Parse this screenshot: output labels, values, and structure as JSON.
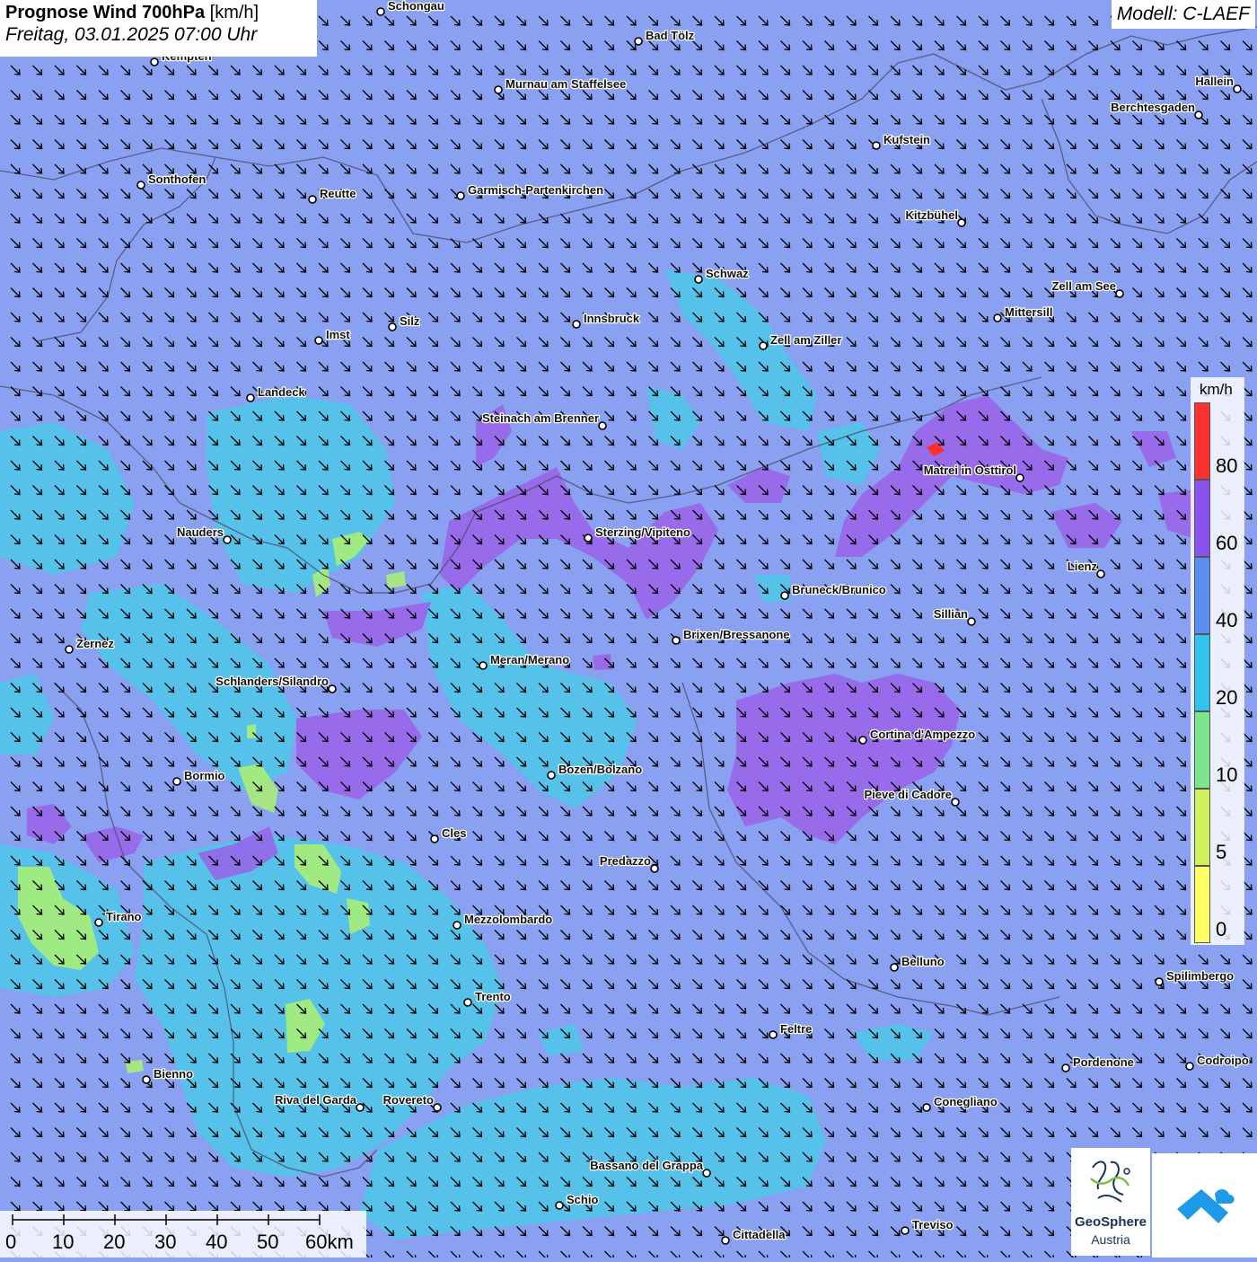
{
  "header": {
    "title_bold": "Prognose Wind 700hPa",
    "title_unit": "[km/h]",
    "datetime": "Freitag, 03.01.2025 07:00 Uhr"
  },
  "model": "Modell: C-LAEF",
  "legend": {
    "unit": "km/h",
    "ticks": [
      "80",
      "60",
      "40",
      "20",
      "10",
      "5",
      "0"
    ],
    "colors": [
      "#ff3030",
      "#8c52ef",
      "#5a8ef0",
      "#31c3ee",
      "#7ce68c",
      "#cdf25a",
      "#ffff66"
    ]
  },
  "scalebar": {
    "labels": [
      "0",
      "10",
      "20",
      "30",
      "40",
      "50",
      "60km"
    ]
  },
  "logos": {
    "geosphere_line1": "GeoSphere",
    "geosphere_line2": "Austria"
  },
  "colors": {
    "background": "#8aa0f0",
    "zone_cyan": "#4ec8e8",
    "zone_purple": "#9a62ea",
    "zone_green": "#a8ee78",
    "zone_red": "#ff3030",
    "arrow": "#000000"
  },
  "places": [
    {
      "name": "Schongau"
    },
    {
      "name": "Bad Tölz"
    },
    {
      "name": "Kempten"
    },
    {
      "name": "Murnau am Staffelsee"
    },
    {
      "name": "Hallein"
    },
    {
      "name": "Berchtesgaden"
    },
    {
      "name": "Kufstein"
    },
    {
      "name": "Sonthofen"
    },
    {
      "name": "Reutte"
    },
    {
      "name": "Garmisch-Partenkirchen"
    },
    {
      "name": "Kitzbühel"
    },
    {
      "name": "Schwaz"
    },
    {
      "name": "Zell am See"
    },
    {
      "name": "Mittersill"
    },
    {
      "name": "Innsbruck"
    },
    {
      "name": "Silz"
    },
    {
      "name": "Imst"
    },
    {
      "name": "Zell am Ziller"
    },
    {
      "name": "Landeck"
    },
    {
      "name": "Steinach am Brenner"
    },
    {
      "name": "Matrei in Osttirol"
    },
    {
      "name": "Nauders"
    },
    {
      "name": "Sterzing/Vipiteno"
    },
    {
      "name": "Lienz"
    },
    {
      "name": "Bruneck/Brunico"
    },
    {
      "name": "Sillian"
    },
    {
      "name": "Zernez"
    },
    {
      "name": "Brixen/Bressanone"
    },
    {
      "name": "Meran/Merano"
    },
    {
      "name": "Schlanders/Silandro"
    },
    {
      "name": "Cortina d'Ampezzo"
    },
    {
      "name": "Bozen/Bolzano"
    },
    {
      "name": "Bormio"
    },
    {
      "name": "Pieve di Cadore"
    },
    {
      "name": "Cles"
    },
    {
      "name": "Predazzo"
    },
    {
      "name": "Tirano"
    },
    {
      "name": "Mezzolombardo"
    },
    {
      "name": "Belluno"
    },
    {
      "name": "Spilimbergo"
    },
    {
      "name": "Trento"
    },
    {
      "name": "Feltre"
    },
    {
      "name": "Bienno"
    },
    {
      "name": "Pordenone"
    },
    {
      "name": "Codroipo"
    },
    {
      "name": "Riva del Garda"
    },
    {
      "name": "Rovereto"
    },
    {
      "name": "Conegliano"
    },
    {
      "name": "Bassano del Grappa"
    },
    {
      "name": "Schio"
    },
    {
      "name": "Treviso"
    },
    {
      "name": "Cittadella"
    }
  ]
}
